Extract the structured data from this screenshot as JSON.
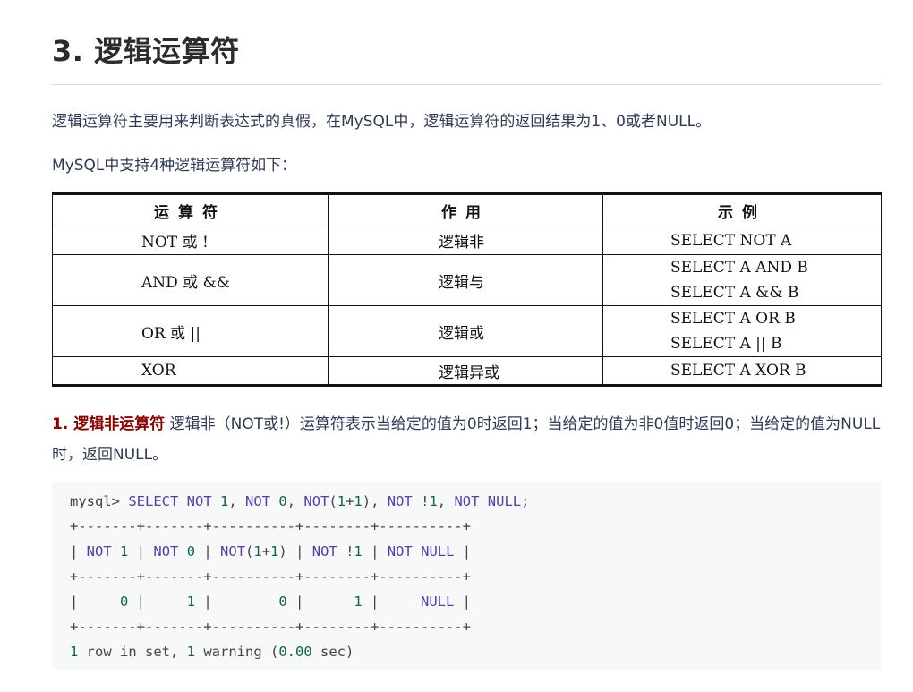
{
  "heading": "3. 逻辑运算符",
  "intro": "逻辑运算符主要用来判断表达式的真假，在MySQL中，逻辑运算符的返回结果为1、0或者NULL。",
  "support_line": "MySQL中支持4种逻辑运算符如下：",
  "table": {
    "headers": [
      "运算符",
      "作用",
      "示例"
    ],
    "rows": [
      {
        "operator": "NOT 或 !",
        "purpose": "逻辑非",
        "examples": [
          "SELECT NOT A"
        ]
      },
      {
        "operator": "AND 或 &&",
        "purpose": "逻辑与",
        "examples": [
          "SELECT A AND B",
          "SELECT A && B"
        ]
      },
      {
        "operator": "OR 或 ||",
        "purpose": "逻辑或",
        "examples": [
          "SELECT A OR B",
          "SELECT A || B"
        ]
      },
      {
        "operator": "XOR",
        "purpose": "逻辑异或",
        "examples": [
          "SELECT A XOR B"
        ]
      }
    ]
  },
  "section": {
    "lead": "1. 逻辑非运算符",
    "text": " 逻辑非（NOT或!）运算符表示当给定的值为0时返回1；当给定的值为非0值时返回0；当给定的值为NULL时，返回NULL。"
  },
  "code": {
    "query": "mysql> SELECT NOT 1, NOT 0, NOT(1+1), NOT !1, NOT NULL;",
    "border": "+-------+-------+----------+--------+----------+",
    "header_row": "| NOT 1 | NOT 0 | NOT(1+1) | NOT !1 | NOT NULL |",
    "value_row": "|     0 |     1 |        0 |      1 |     NULL |",
    "footer": "1 row in set, 1 warning (0.00 sec)"
  }
}
